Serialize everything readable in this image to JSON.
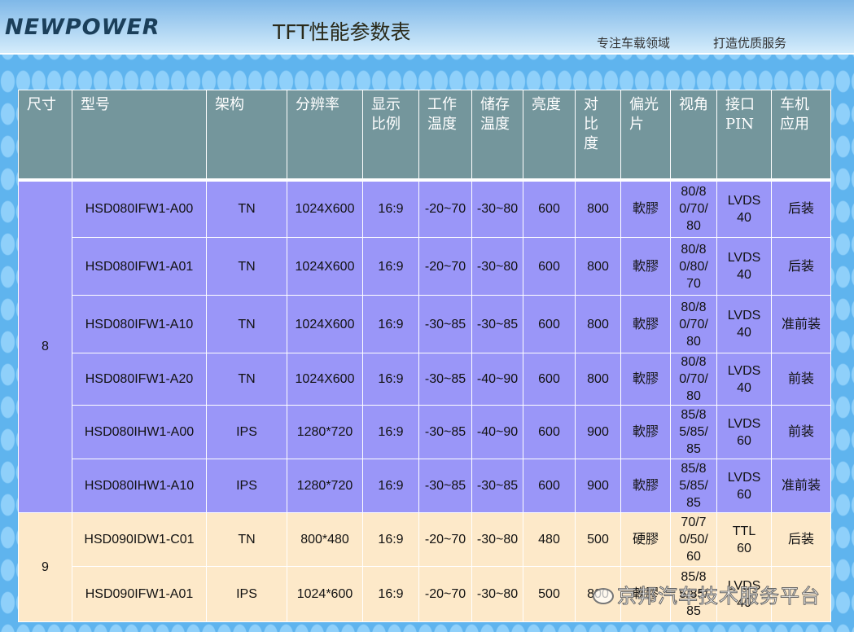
{
  "header": {
    "logo": "NEWPOWER",
    "title": "TFT性能参数表",
    "slogan1": "专注车载领域",
    "slogan2": "打造优质服务"
  },
  "columns": [
    "尺寸",
    "型号",
    "架构",
    "分辨率",
    "显示比例",
    "工作温度",
    "储存温度",
    "亮度",
    "对比度",
    "偏光片",
    "视角",
    "接口PIN",
    "车机应用"
  ],
  "groups": [
    {
      "size": "8",
      "rows": [
        [
          "HSD080IFW1-A00",
          "TN",
          "1024X600",
          "16:9",
          "-20~70",
          "-30~80",
          "600",
          "800",
          "軟膠",
          "80/80/70/80",
          "LVDS 40",
          "后装"
        ],
        [
          "HSD080IFW1-A01",
          "TN",
          "1024X600",
          "16:9",
          "-20~70",
          "-30~80",
          "600",
          "800",
          "軟膠",
          "80/80/80/70",
          "LVDS 40",
          "后装"
        ],
        [
          "HSD080IFW1-A10",
          "TN",
          "1024X600",
          "16:9",
          "-30~85",
          "-30~85",
          "600",
          "800",
          "軟膠",
          "80/80/70/80",
          "LVDS 40",
          "准前装"
        ],
        [
          "HSD080IFW1-A20",
          "TN",
          "1024X600",
          "16:9",
          "-30~85",
          "-40~90",
          "600",
          "800",
          "軟膠",
          "80/80/70/80",
          "LVDS 40",
          "前装"
        ],
        [
          "HSD080IHW1-A00",
          "IPS",
          "1280*720",
          "16:9",
          "-30~85",
          "-40~90",
          "600",
          "900",
          "軟膠",
          "85/85/85/85",
          "LVDS 60",
          "前装"
        ],
        [
          "HSD080IHW1-A10",
          "IPS",
          "1280*720",
          "16:9",
          "-30~85",
          "-30~85",
          "600",
          "900",
          "軟膠",
          "85/85/85/85",
          "LVDS 60",
          "准前装"
        ]
      ]
    },
    {
      "size": "9",
      "rows": [
        [
          "HSD090IDW1-C01",
          "TN",
          "800*480",
          "16:9",
          "-20~70",
          "-30~80",
          "480",
          "500",
          "硬膠",
          "70/70/50/60",
          "TTL 60",
          "后装"
        ],
        [
          "HSD090IFW1-A01",
          "IPS",
          "1024*600",
          "16:9",
          "-20~70",
          "-30~80",
          "500",
          "800",
          "軟膠",
          "85/85/85/85",
          "LVDS 40",
          ""
        ]
      ]
    }
  ],
  "watermark": "京邦汽车技术服务平台",
  "colors": {
    "header": "#74969c",
    "group8": "#9a96f8",
    "group9": "#fde9c9"
  }
}
